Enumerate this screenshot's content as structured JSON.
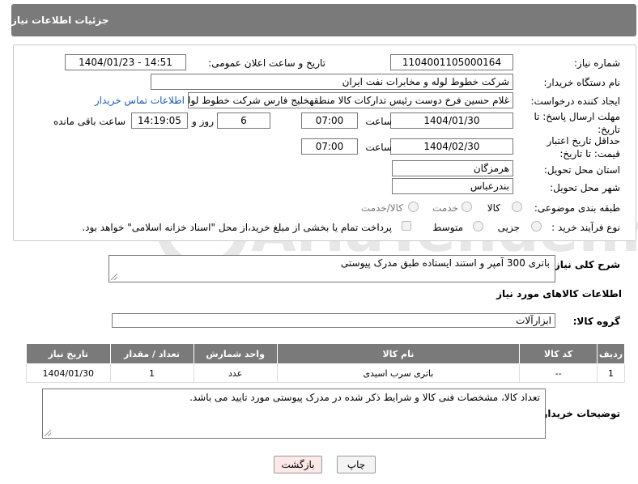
{
  "header": {
    "title": "جزئیات اطلاعات نیاز"
  },
  "form": {
    "need_number": {
      "label": "شماره نیاز:",
      "value": "1104001105000164"
    },
    "announce_datetime": {
      "label": "تاریخ و ساعت اعلان عمومی:",
      "value": "1404/01/23 - 14:51"
    },
    "buyer_org": {
      "label": "نام دستگاه خریدار:",
      "value": "شرکت خطوط لوله و مخابرات نفت ایران"
    },
    "requester": {
      "label": "ایجاد کننده درخواست:",
      "value": "غلام حسین فرخ دوست رئیس تدارکات کالا منطقهخلیج فارس شرکت خطوط لوله",
      "contact_link": "اطلاعات تماس خریدار"
    },
    "reply_deadline": {
      "label": "مهلت ارسال پاسخ: تا تاریخ:",
      "date": "1404/01/30",
      "time_label": "ساعت",
      "time": "07:00",
      "days": "6",
      "days_label": "روز و",
      "remaining": "14:19:05",
      "remaining_label": "ساعت باقی مانده"
    },
    "price_validity": {
      "label": "حداقل تاریخ اعتبار قیمت: تا تاریخ:",
      "date": "1404/02/30",
      "time_label": "ساعت",
      "time": "07:00"
    },
    "province": {
      "label": "استان محل تحویل:",
      "value": "هرمزگان"
    },
    "city": {
      "label": "شهر محل تحویل:",
      "value": "بندرعباس"
    },
    "category": {
      "label": "طبقه بندی موضوعی:",
      "options": [
        "کالا",
        "خدمت",
        "کالا/خدمت"
      ]
    },
    "process": {
      "label": "نوع فرآیند خرید :",
      "options": [
        "جزیی",
        "متوسط"
      ],
      "payment_note": "پرداخت تمام یا بخشی از مبلغ خرید،از محل \"اسناد خزانه اسلامی\" خواهد بود."
    }
  },
  "description": {
    "label": "شرح کلی نیاز:",
    "value": "باتری 300 آمپر و استند ایستاده طبق مدرک پیوستی"
  },
  "goods_section": {
    "title": "اطلاعات کالاهای مورد نیاز",
    "group_label": "گروه کالا:",
    "group_value": "ابزارآلات"
  },
  "table": {
    "headers": [
      "ردیف",
      "کد کالا",
      "نام کالا",
      "واحد شمارش",
      "تعداد / مقدار",
      "تاریخ نیاز"
    ],
    "rows": [
      [
        "1",
        "--",
        "باتری سرب اسیدی",
        "عدد",
        "1",
        "1404/01/30"
      ]
    ]
  },
  "buyer_notes": {
    "label": "توضیحات خریدار:",
    "value": "تعداد کالا، مشخصات فنی کالا و شرایط ذکر شده در مدرک پیوستی مورد تایید می باشد."
  },
  "buttons": {
    "print": "چاپ",
    "back": "بازگشت"
  },
  "colors": {
    "header_bg": "#7a7a7a",
    "link": "#1a5db3",
    "back_button_bg": "#fde8e8"
  },
  "watermark": {
    "text": "AriaTender.neT"
  }
}
